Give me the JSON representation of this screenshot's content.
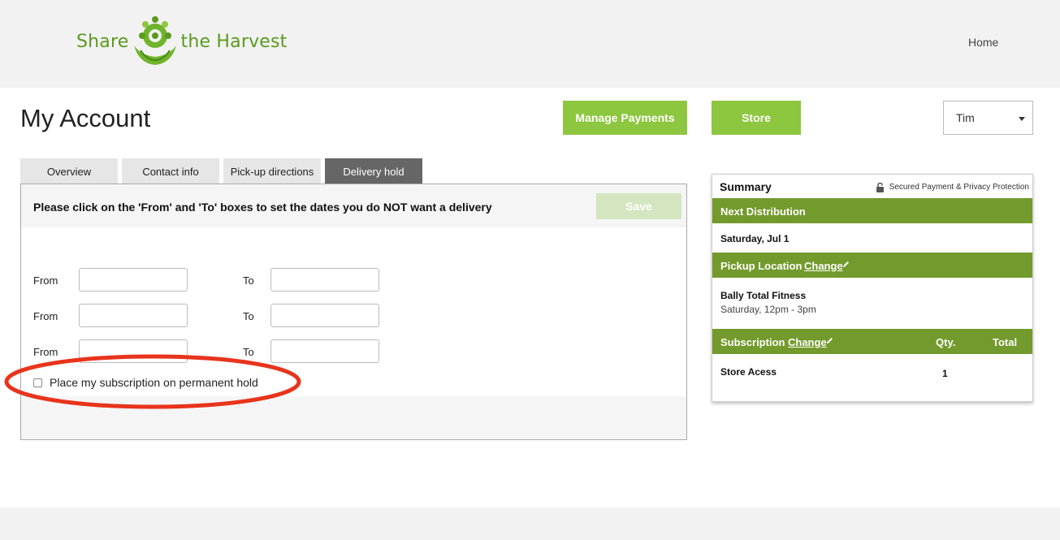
{
  "brand": {
    "left": "Share",
    "right": "the Harvest"
  },
  "nav": {
    "home": "Home"
  },
  "page": {
    "title": "My Account"
  },
  "actions": {
    "manage_payments": "Manage Payments",
    "store": "Store"
  },
  "user_menu": {
    "selected": "Tim"
  },
  "tabs": [
    {
      "label": "Overview"
    },
    {
      "label": "Contact info"
    },
    {
      "label": "Pick-up directions"
    },
    {
      "label": "Delivery hold"
    }
  ],
  "active_tab": "Delivery hold",
  "delivery_hold": {
    "instruction": "Please click on the 'From' and 'To' boxes to set the dates you do NOT want a delivery",
    "save_label": "Save",
    "from_label": "From",
    "to_label": "To",
    "permanent_hold_label": "Place my subscription on permanent hold",
    "permanent_hold_checked": false
  },
  "summary": {
    "title": "Summary",
    "secure_text": "Secured Payment & Privacy Protection",
    "next_distribution_label": "Next Distribution",
    "next_distribution_date": "Saturday, Jul 1",
    "pickup_location_label": "Pickup Location",
    "change_label": "Change",
    "pickup_name": "Bally Total Fitness",
    "pickup_time": "Saturday, 12pm - 3pm",
    "subscription_label": "Subscription",
    "qty_label": "Qty.",
    "total_label": "Total",
    "items": [
      {
        "name": "Store Acess",
        "qty": "1",
        "total": ""
      }
    ]
  },
  "colors": {
    "brand_green": "#5a9a1f",
    "button_green": "#8dc63f",
    "bar_green": "#739a2c",
    "save_disabled": "#d4e6c0",
    "active_tab": "#666666",
    "highlight_red": "#e8341c"
  }
}
